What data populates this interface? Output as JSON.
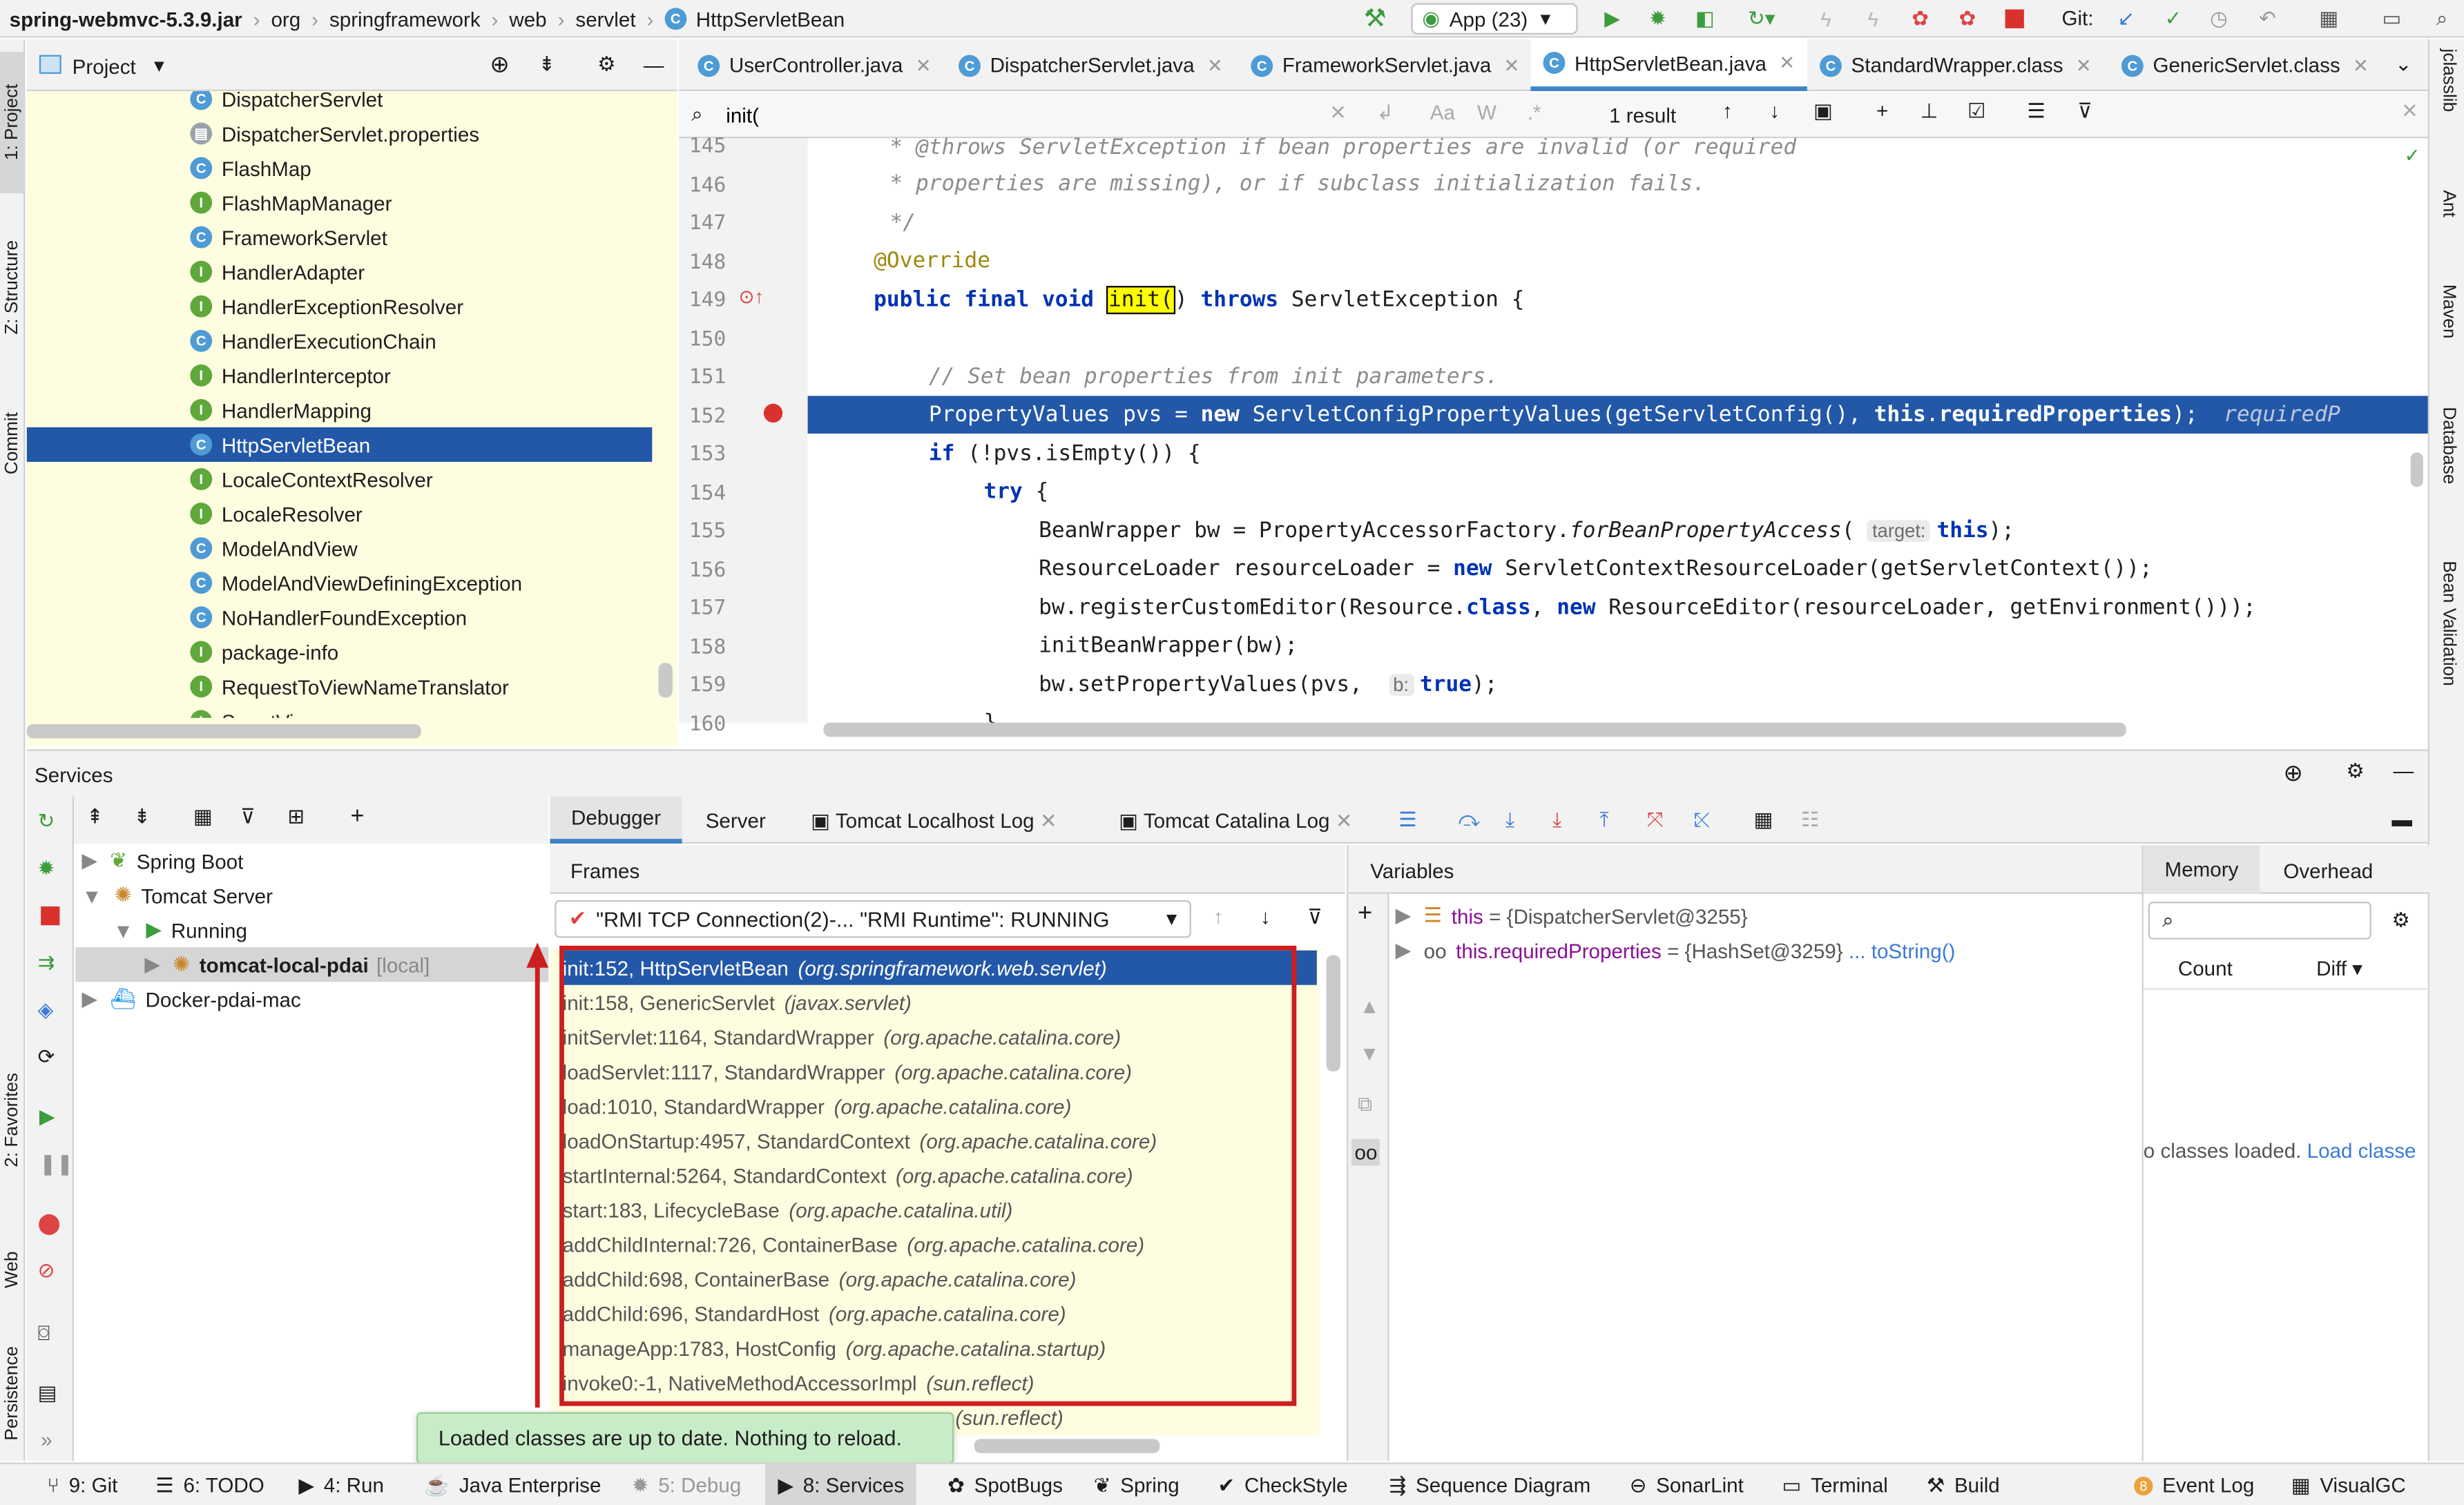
{
  "nav": {
    "crumbs": [
      "spring-webmvc-5.3.9.jar",
      "org",
      "springframework",
      "web",
      "servlet",
      "HttpServletBean"
    ],
    "run_config": "App (23)",
    "git_label": "Git:"
  },
  "left_strip": [
    "1: Project",
    "Z: Structure",
    "Commit",
    "2: Favorites",
    "Web",
    "Persistence"
  ],
  "right_strip": [
    "jclasslib",
    "Ant",
    "Maven",
    "Database",
    "Bean Validation"
  ],
  "project": {
    "title": "Project",
    "items": [
      {
        "label": "DispatcherServlet",
        "kind": "c"
      },
      {
        "label": "DispatcherServlet.properties",
        "kind": "f"
      },
      {
        "label": "FlashMap",
        "kind": "c"
      },
      {
        "label": "FlashMapManager",
        "kind": "i"
      },
      {
        "label": "FrameworkServlet",
        "kind": "c"
      },
      {
        "label": "HandlerAdapter",
        "kind": "i"
      },
      {
        "label": "HandlerExceptionResolver",
        "kind": "i"
      },
      {
        "label": "HandlerExecutionChain",
        "kind": "c"
      },
      {
        "label": "HandlerInterceptor",
        "kind": "i"
      },
      {
        "label": "HandlerMapping",
        "kind": "i"
      },
      {
        "label": "HttpServletBean",
        "kind": "c"
      },
      {
        "label": "LocaleContextResolver",
        "kind": "i"
      },
      {
        "label": "LocaleResolver",
        "kind": "i"
      },
      {
        "label": "ModelAndView",
        "kind": "c"
      },
      {
        "label": "ModelAndViewDefiningException",
        "kind": "e"
      },
      {
        "label": "NoHandlerFoundException",
        "kind": "e"
      },
      {
        "label": "package-info",
        "kind": "i"
      },
      {
        "label": "RequestToViewNameTranslator",
        "kind": "i"
      },
      {
        "label": "SmartView",
        "kind": "i"
      }
    ]
  },
  "editor": {
    "tabs": [
      "UserController.java",
      "DispatcherServlet.java",
      "FrameworkServlet.java",
      "HttpServletBean.java",
      "StandardWrapper.class",
      "GenericServlet.class"
    ],
    "search_value": "init(",
    "result_count": "1 result",
    "line_numbers": [
      "145",
      "146",
      "147",
      "148",
      "149",
      "150",
      "151",
      "152",
      "153",
      "154",
      "155",
      "156",
      "157",
      "158",
      "159",
      "160"
    ]
  },
  "services": {
    "title": "Services",
    "tree": [
      "Spring Boot",
      "Tomcat Server",
      "Running",
      "tomcat-local-pdai",
      "[local]",
      "Docker-pdai-mac"
    ],
    "debug_tabs": [
      "Debugger",
      "Server",
      "Tomcat Localhost Log",
      "Tomcat Catalina Log"
    ],
    "frames_title": "Frames",
    "thread": "\"RMI TCP Connection(2)-... \"RMI Runtime\": RUNNING",
    "frames": [
      {
        "m": "init:152, HttpServletBean",
        "p": "(org.springframework.web.servlet)"
      },
      {
        "m": "init:158, GenericServlet",
        "p": "(javax.servlet)"
      },
      {
        "m": "initServlet:1164, StandardWrapper",
        "p": "(org.apache.catalina.core)"
      },
      {
        "m": "loadServlet:1117, StandardWrapper",
        "p": "(org.apache.catalina.core)"
      },
      {
        "m": "load:1010, StandardWrapper",
        "p": "(org.apache.catalina.core)"
      },
      {
        "m": "loadOnStartup:4957, StandardContext",
        "p": "(org.apache.catalina.core)"
      },
      {
        "m": "startInternal:5264, StandardContext",
        "p": "(org.apache.catalina.core)"
      },
      {
        "m": "start:183, LifecycleBase",
        "p": "(org.apache.catalina.util)"
      },
      {
        "m": "addChildInternal:726, ContainerBase",
        "p": "(org.apache.catalina.core)"
      },
      {
        "m": "addChild:698, ContainerBase",
        "p": "(org.apache.catalina.core)"
      },
      {
        "m": "addChild:696, StandardHost",
        "p": "(org.apache.catalina.core)"
      },
      {
        "m": "manageApp:1783, HostConfig",
        "p": "(org.apache.catalina.startup)"
      },
      {
        "m": "invoke0:-1, NativeMethodAccessorImpl",
        "p": "(sun.reflect)"
      },
      {
        "m": "",
        "p": "(sun.reflect)"
      }
    ],
    "variables_title": "Variables",
    "vars": [
      {
        "name": "this",
        "value": "= {DispatcherServlet@3255}",
        "extra": ""
      },
      {
        "name": "this.requiredProperties",
        "value": "= {HashSet@3259}",
        "extra": "... toString()"
      }
    ],
    "memory_tabs": [
      "Memory",
      "Overhead"
    ],
    "memory_cols": [
      "Count",
      "Diff"
    ],
    "memory_msg": "o classes loaded.",
    "memory_link": "Load classe"
  },
  "toast": "Loaded classes are up to date. Nothing to reload.",
  "bottom": [
    "9: Git",
    "6: TODO",
    "4: Run",
    "Java Enterprise",
    "5: Debug",
    "8: Services",
    "SpotBugs",
    "Spring",
    "CheckStyle",
    "Sequence Diagram",
    "SonarLint",
    "Terminal",
    "Build",
    "Event Log",
    "VisualGC"
  ],
  "event_badge": "8",
  "colors": {
    "selection": "#2358a8",
    "highlight_box": "#cc1f1f",
    "tree_bg": "#fefde0",
    "toast_bg": "#c8ebc8"
  }
}
